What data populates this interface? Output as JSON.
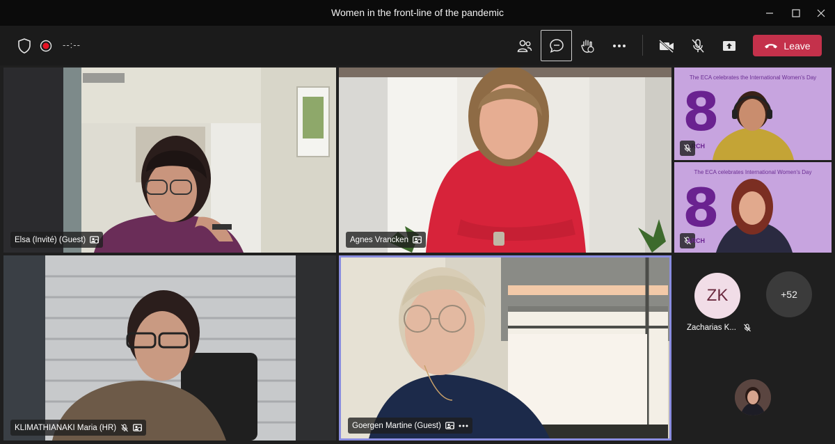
{
  "window": {
    "title": "Women in the front-line of the pandemic"
  },
  "toolbar": {
    "timer": "--:--",
    "leave_label": "Leave",
    "colors": {
      "leave": "#c4314b",
      "record": "#e81123",
      "active_outline": "#ffffff"
    }
  },
  "participants": [
    {
      "name": "Elsa (Invité) (Guest)"
    },
    {
      "name": "Agnes Vrancken"
    },
    {
      "name": "KLIMATHIANAKI Maria (HR)"
    },
    {
      "name": "Goergen Martine (Guest)"
    }
  ],
  "side_tiles": [
    {
      "banner": "The ECA celebrates the International Women's Day",
      "big_number": "8",
      "sub": "ARCH"
    },
    {
      "banner": "The ECA celebrates International Women's Day",
      "big_number": "8",
      "sub": "ARCH"
    }
  ],
  "roster": {
    "avatar_initials": "ZK",
    "avatar_name": "Zacharias K...",
    "overflow_count": "+52"
  },
  "icons": [
    "shield-icon",
    "record-icon",
    "people-icon",
    "chat-icon",
    "raise-hand-icon",
    "more-icon",
    "camera-off-icon",
    "mic-off-icon",
    "share-icon",
    "phone-icon",
    "minimize-icon",
    "maximize-icon",
    "close-icon"
  ]
}
